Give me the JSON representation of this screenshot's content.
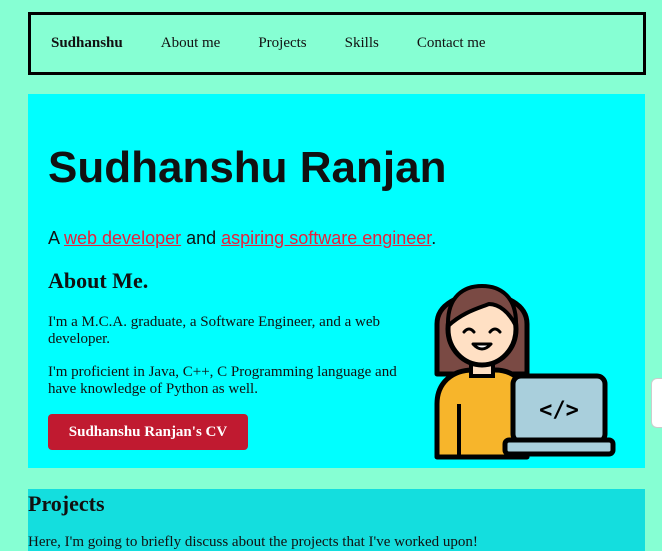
{
  "nav": {
    "brand": "Sudhanshu",
    "links": [
      "About me",
      "Projects",
      "Skills",
      "Contact me"
    ]
  },
  "hero": {
    "title": "Sudhanshu Ranjan",
    "tagline": {
      "prefix": "A ",
      "link1": "web developer",
      "middle": " and ",
      "link2": "aspiring software engineer",
      "suffix": "."
    },
    "about_heading": "About Me.",
    "about_p1": "I'm a M.C.A. graduate, a Software Engineer, and a web developer.",
    "about_p2": "I'm proficient in Java, C++, C Programming language and have knowledge of Python as well.",
    "cv_button": "Sudhanshu Ranjan's CV",
    "illustration_icon": "developer-avatar-icon",
    "code_symbol": "</>"
  },
  "projects": {
    "heading": "Projects",
    "intro": "Here, I'm going to briefly discuss about the projects that I've worked upon!"
  },
  "colors": {
    "page_bg": "#86ffd3",
    "hero_bg": "#00ffff",
    "projects_bg": "#14dede",
    "link": "#e6213a",
    "button": "#c01a30"
  }
}
